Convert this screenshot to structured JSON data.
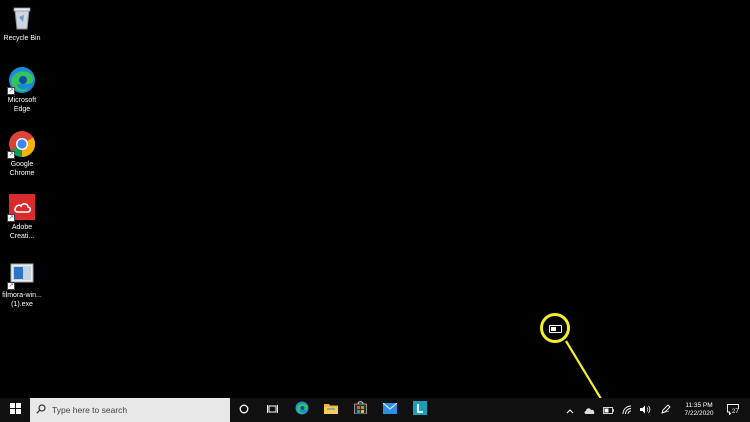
{
  "desktop": {
    "icons": [
      {
        "label": "Recycle Bin"
      },
      {
        "label": "Microsoft Edge"
      },
      {
        "label": "Google Chrome"
      },
      {
        "label": "Adobe Creati..."
      },
      {
        "label": "filmora-win... (1).exe"
      }
    ]
  },
  "taskbar": {
    "search_placeholder": "Type here to search",
    "clock": {
      "time": "11:35 PM",
      "date": "7/22/2020"
    },
    "notification_count": "27"
  },
  "colors": {
    "callout": "#f5ee2a",
    "taskbar": "#101010",
    "search_bg": "#e8e8e8"
  }
}
